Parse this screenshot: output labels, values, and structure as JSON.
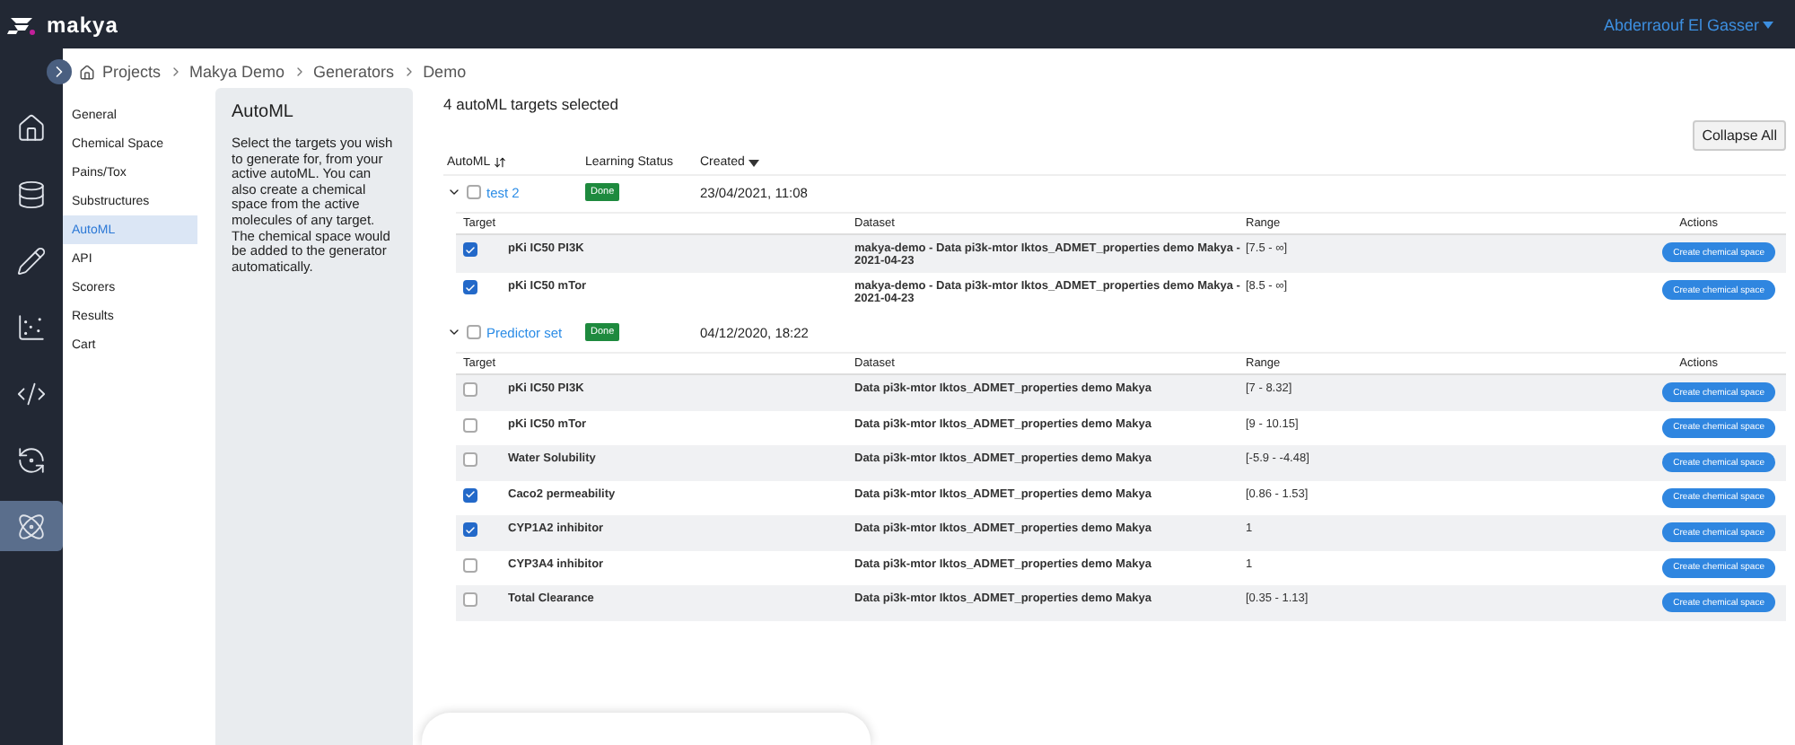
{
  "topbar": {
    "logo": "makya",
    "user": "Abderraouf El Gasser"
  },
  "rail": [
    {
      "selected": false
    },
    {
      "selected": false
    },
    {
      "selected": false
    },
    {
      "selected": false
    },
    {
      "selected": false
    },
    {
      "selected": false
    },
    {
      "selected": true
    }
  ],
  "breadcrumb": [
    "Projects",
    "Makya Demo",
    "Generators",
    "Demo"
  ],
  "submenu": [
    {
      "label": "General",
      "selected": false
    },
    {
      "label": "Chemical Space",
      "selected": false
    },
    {
      "label": "Pains/Tox",
      "selected": false
    },
    {
      "label": "Substructures",
      "selected": false
    },
    {
      "label": "AutoML",
      "selected": true
    },
    {
      "label": "API",
      "selected": false
    },
    {
      "label": "Scorers",
      "selected": false
    },
    {
      "label": "Results",
      "selected": false
    },
    {
      "label": "Cart",
      "selected": false
    }
  ],
  "info": {
    "title": "AutoML",
    "text": "Select the targets you wish to generate for, from your active autoML. You can also create a chemical space from the active molecules of any target. The chemical space would be added to the generator automatically."
  },
  "summary": "4 autoML targets selected",
  "collapse_button": "Collapse All",
  "columns": [
    "AutoML",
    "Learning Status",
    "Created"
  ],
  "groups": [
    {
      "name": "test 2",
      "expanded": true,
      "checked": false,
      "status": "Done",
      "created": "23/04/2021, 11:08",
      "sub_columns": [
        "Target",
        "Dataset",
        "Range",
        "Actions"
      ],
      "targets": [
        {
          "target": "pKi IC50 PI3K",
          "dataset": "makya-demo - Data pi3k-mtor Iktos_ADMET_properties demo Makya - 2021-04-23",
          "range": "[7.5 - ∞]",
          "checked": true,
          "action": "Create chemical space"
        },
        {
          "target": "pKi IC50 mTor",
          "dataset": "makya-demo - Data pi3k-mtor Iktos_ADMET_properties demo Makya - 2021-04-23",
          "range": "[8.5 - ∞]",
          "checked": true,
          "action": "Create chemical space"
        }
      ]
    },
    {
      "name": "Predictor set",
      "expanded": true,
      "checked": false,
      "status": "Done",
      "created": "04/12/2020, 18:22",
      "sub_columns": [
        "Target",
        "Dataset",
        "Range",
        "Actions"
      ],
      "targets": [
        {
          "target": "pKi IC50 PI3K",
          "dataset": "Data pi3k-mtor Iktos_ADMET_properties demo Makya",
          "range": "[7 - 8.32]",
          "checked": false,
          "action": "Create chemical space"
        },
        {
          "target": "pKi IC50 mTor",
          "dataset": "Data pi3k-mtor Iktos_ADMET_properties demo Makya",
          "range": "[9 - 10.15]",
          "checked": false,
          "action": "Create chemical space"
        },
        {
          "target": "Water Solubility",
          "dataset": "Data pi3k-mtor Iktos_ADMET_properties demo Makya",
          "range": "[-5.9 - -4.48]",
          "checked": false,
          "action": "Create chemical space"
        },
        {
          "target": "Caco2 permeability",
          "dataset": "Data pi3k-mtor Iktos_ADMET_properties demo Makya",
          "range": "[0.86 - 1.53]",
          "checked": true,
          "action": "Create chemical space"
        },
        {
          "target": "CYP1A2 inhibitor",
          "dataset": "Data pi3k-mtor Iktos_ADMET_properties demo Makya",
          "range": "1",
          "checked": true,
          "action": "Create chemical space"
        },
        {
          "target": "CYP3A4 inhibitor",
          "dataset": "Data pi3k-mtor Iktos_ADMET_properties demo Makya",
          "range": "1",
          "checked": false,
          "action": "Create chemical space"
        },
        {
          "target": "Total Clearance",
          "dataset": "Data pi3k-mtor Iktos_ADMET_properties demo Makya",
          "range": "[0.35 - 1.13]",
          "checked": false,
          "action": "Create chemical space"
        }
      ]
    }
  ]
}
